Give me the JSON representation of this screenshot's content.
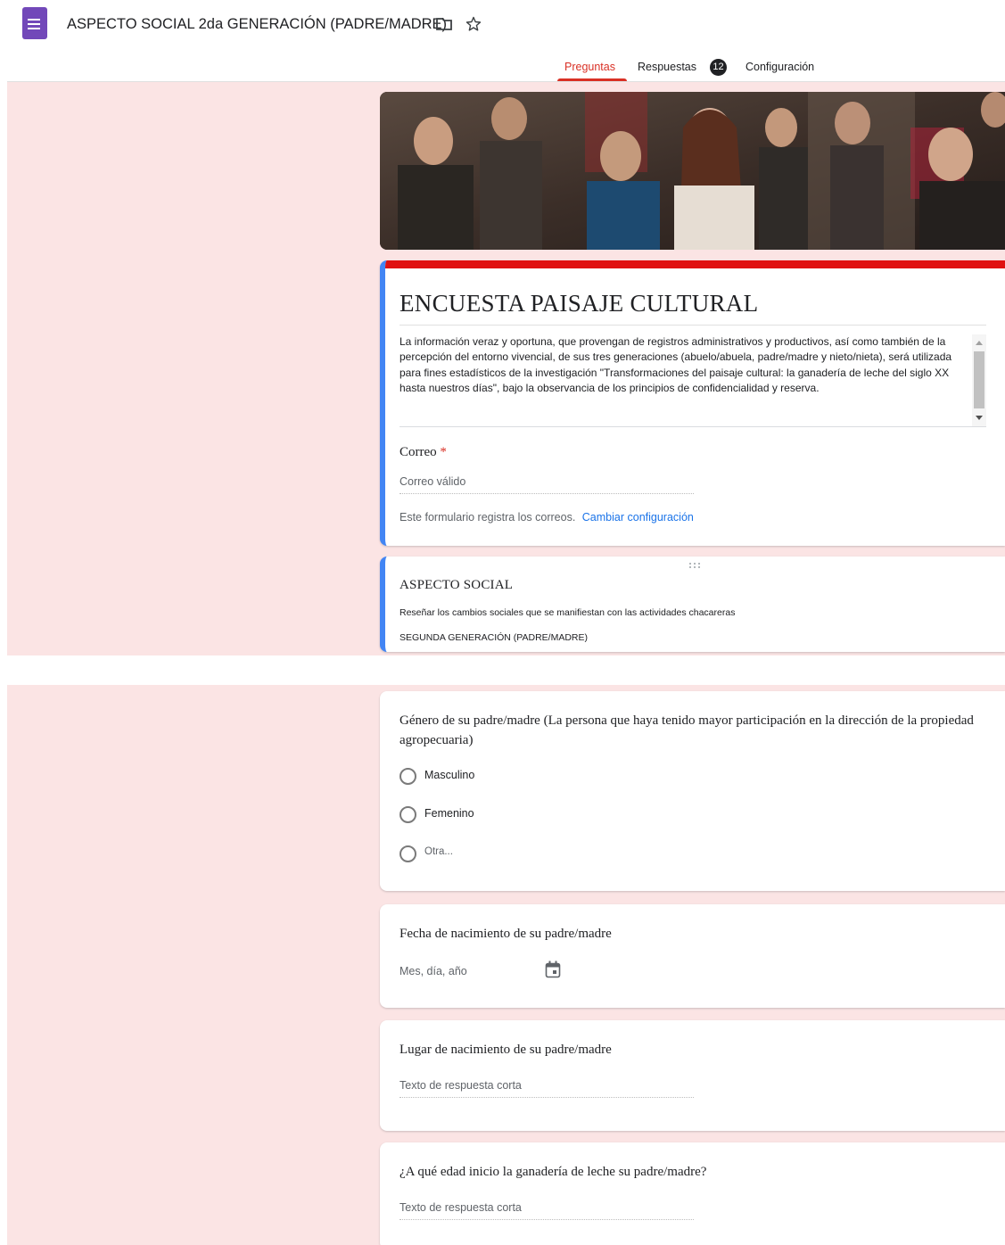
{
  "header": {
    "doc_title": "ASPECTO SOCIAL 2da GENERACIÓN (PADRE/MADRE)",
    "icons": [
      "forms-app-icon",
      "folder-icon",
      "star-icon"
    ]
  },
  "tabs": {
    "preguntas": "Preguntas",
    "respuestas": "Respuestas",
    "respuestas_count": "12",
    "configuracion": "Configuración",
    "active": "Preguntas"
  },
  "colors": {
    "accent": "#d93025",
    "theme_red": "#e01010",
    "selected_border": "#4285f4",
    "background": "#fbe4e4",
    "link": "#1a73e8"
  },
  "form": {
    "title": "ENCUESTA PAISAJE CULTURAL",
    "description": "La información veraz y oportuna, que provengan de registros administrativos y productivos, así como también de la percepción del entorno vivencial, de sus tres generaciones (abuelo/abuela, padre/madre y nieto/nieta), será utilizada para fines estadísticos de la investigación \"Transformaciones del paisaje cultural: la ganadería de leche del siglo XX hasta nuestros días\", bajo la observancia de los principios de confidencialidad y reserva.",
    "email_label": "Correo",
    "required_mark": "*",
    "email_placeholder": "Correo válido",
    "email_note": "Este formulario registra los correos.",
    "email_link": "Cambiar configuración"
  },
  "section": {
    "title": "ASPECTO SOCIAL",
    "description": "Reseñar los cambios sociales que se manifiestan con las actividades chacareras",
    "subtitle": "SEGUNDA GENERACIÓN  (PADRE/MADRE)"
  },
  "questions": [
    {
      "title": "Género de su padre/madre (La persona que haya tenido mayor participación en la dirección de la propiedad agropecuaria)",
      "options": [
        "Masculino",
        "Femenino",
        "Otra..."
      ]
    },
    {
      "title": "Fecha de nacimiento de su padre/madre",
      "placeholder": "Mes, día, año"
    },
    {
      "title": "Lugar de nacimiento de su padre/madre",
      "placeholder": "Texto de respuesta corta"
    },
    {
      "title": "¿A qué edad inicio la ganadería de leche su padre/madre?",
      "placeholder": "Texto de respuesta corta"
    }
  ]
}
